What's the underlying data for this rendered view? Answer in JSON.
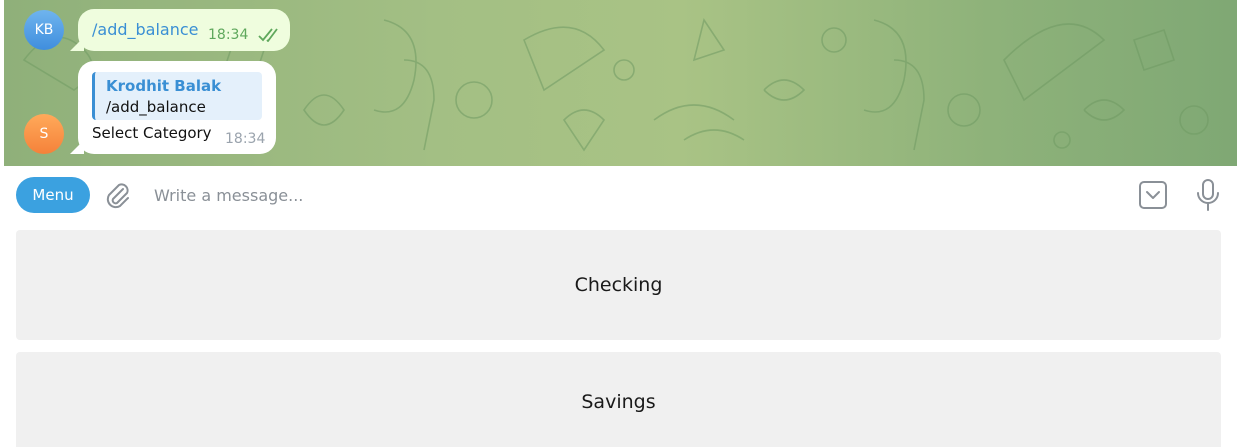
{
  "chat": {
    "outgoing": {
      "avatar_initials": "KB",
      "text": "/add_balance",
      "time": "18:34",
      "status_icon": "double-check-icon"
    },
    "incoming": {
      "avatar_initials": "S",
      "reply_to_name": "Krodhit Balak",
      "reply_to_text": "/add_balance",
      "text": "Select Category",
      "time": "18:34"
    }
  },
  "composer": {
    "menu_label": "Menu",
    "placeholder": "Write a message...",
    "attach_icon": "paperclip-icon",
    "keyboard_icon": "keyboard-toggle-icon",
    "mic_icon": "microphone-icon"
  },
  "keyboard": {
    "buttons": [
      "Checking",
      "Savings"
    ]
  },
  "colors": {
    "accent": "#3ba1e0",
    "outgoing_bubble": "#effdde",
    "chat_background": "#a3bf84",
    "reply_bg": "#e4f0fb",
    "keyboard_button": "#f0f0f0"
  }
}
